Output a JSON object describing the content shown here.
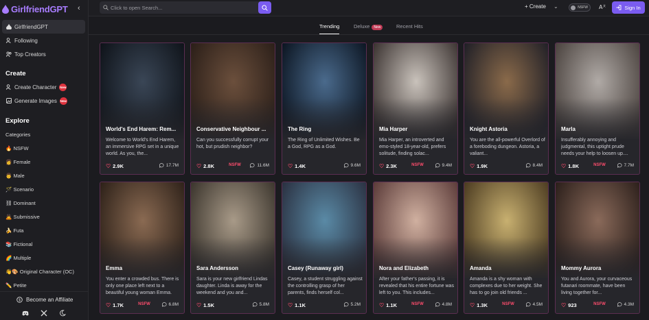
{
  "app": {
    "brand": "GirlfriendGPT",
    "collapse_icon": "chevron-left-icon"
  },
  "sidebar": {
    "nav": [
      {
        "label": "GirlfriendGPT",
        "icon": "logo-icon",
        "active": true
      },
      {
        "label": "Following",
        "icon": "user-plus-icon",
        "active": false
      },
      {
        "label": "Top Creators",
        "icon": "users-icon",
        "active": false
      }
    ],
    "create_heading": "Create",
    "create_items": [
      {
        "label": "Create Character",
        "icon": "user-plus-icon",
        "badge": "New"
      },
      {
        "label": "Generate Images",
        "icon": "image-icon",
        "badge": "New"
      }
    ],
    "explore_heading": "Explore",
    "categories_label": "Categories",
    "categories": [
      {
        "emoji": "🔥",
        "label": "NSFW"
      },
      {
        "emoji": "👩",
        "label": "Female"
      },
      {
        "emoji": "👨",
        "label": "Male"
      },
      {
        "emoji": "🪄",
        "label": "Scenario"
      },
      {
        "emoji": "⛓",
        "label": "Dominant"
      },
      {
        "emoji": "🙇",
        "label": "Submissive"
      },
      {
        "emoji": "🍌",
        "label": "Futa"
      },
      {
        "emoji": "📚",
        "label": "Fictional"
      },
      {
        "emoji": "🌈",
        "label": "Multiple"
      },
      {
        "emoji": "👋🎨",
        "label": "Original Character (OC)"
      },
      {
        "emoji": "✏️",
        "label": "Petite"
      }
    ],
    "affiliate_label": "Become an Affiliate",
    "footer_icons": [
      "discord-icon",
      "x-icon",
      "moon-icon"
    ]
  },
  "topbar": {
    "search_placeholder": "Click to open Search...",
    "create_label": "+ Create",
    "nsfw_label": "NSFW",
    "signin_label": "Sign In"
  },
  "tabs": [
    {
      "label": "Trending",
      "active": true
    },
    {
      "label": "Deluxe",
      "badge": "New",
      "active": false
    },
    {
      "label": "Recent Hits",
      "active": false
    }
  ],
  "cards": [
    {
      "name": "World's End Harem: Rem...",
      "desc": "Welcome to World's End Harem, an immersive RPG set in a unique world. As you, the...",
      "likes": "2.9K",
      "nsfw": "",
      "chats": "17.7M",
      "bg": [
        "#3a4656",
        "#0e1218"
      ]
    },
    {
      "name": "Conservative Neighbour ...",
      "desc": "Can you successfully corrupt your hot, but prudish neighbor?",
      "likes": "2.8K",
      "nsfw": "NSFW",
      "chats": "11.6M",
      "bg": [
        "#6b4f3c",
        "#2a1e18"
      ]
    },
    {
      "name": "The Ring",
      "desc": "The Ring of Unlimited Wishes. Be a God, RPG as a God.",
      "likes": "1.4K",
      "nsfw": "",
      "chats": "9.6M",
      "bg": [
        "#4a6a8c",
        "#0b1420"
      ]
    },
    {
      "name": "Mia Harper",
      "desc": "Mia Harper, an introverted and emo-styled 18-year-old, prefers solitude, finding solac...",
      "likes": "2.3K",
      "nsfw": "NSFW",
      "chats": "9.4M",
      "bg": [
        "#c9c2bb",
        "#3a3230"
      ]
    },
    {
      "name": "Knight Astoria",
      "desc": "You are the all-powerful Overlord of a foreboding dungeon. Astoria, a valiant...",
      "likes": "1.9K",
      "nsfw": "",
      "chats": "8.4M",
      "bg": [
        "#8a6a4a",
        "#1e1e26"
      ]
    },
    {
      "name": "Marla",
      "desc": "Insufferably annoying and judgmental, this uptight prude needs your help to loosen up....",
      "likes": "1.8K",
      "nsfw": "NSFW",
      "chats": "7.7M",
      "bg": [
        "#b0aaa6",
        "#4a423e"
      ]
    },
    {
      "name": "Emma",
      "desc": "You enter a crowded bus. There is only one place left next to a beautiful young woman Emma.",
      "likes": "1.7K",
      "nsfw": "NSFW",
      "chats": "6.8M",
      "bg": [
        "#8a6a52",
        "#2c2018"
      ]
    },
    {
      "name": "Sara Andersson",
      "desc": "Sara is your new girlfriend Lindas daughter. Linda is away for the weekend and you and...",
      "likes": "1.5K",
      "nsfw": "",
      "chats": "5.8M",
      "bg": [
        "#a89a88",
        "#3a342c"
      ]
    },
    {
      "name": "Casey (Runaway girl)",
      "desc": "Casey, a student struggling against the controlling grasp of her parents, finds herself col...",
      "likes": "1.1K",
      "nsfw": "",
      "chats": "5.2M",
      "bg": [
        "#5a8aa6",
        "#2a3040"
      ]
    },
    {
      "name": "Nora and Elizabeth",
      "desc": "After your father's passing, it is revealed that his entire fortune was left to you. This includes...",
      "likes": "1.1K",
      "nsfw": "NSFW",
      "chats": "4.8M",
      "bg": [
        "#d0b0a0",
        "#5a3a38"
      ]
    },
    {
      "name": "Amanda",
      "desc": "Amanda is a shy woman with complexes due to her weight. She has to go join old friends ...",
      "likes": "1.3K",
      "nsfw": "NSFW",
      "chats": "4.5M",
      "bg": [
        "#c8b070",
        "#4a3a20"
      ]
    },
    {
      "name": "Mommy Aurora",
      "desc": "You and Aurora, your curvaceous futanari roommate, have been living together for...",
      "likes": "923",
      "nsfw": "NSFW",
      "chats": "4.3M",
      "bg": [
        "#8a6a5a",
        "#2a1e1a"
      ]
    }
  ],
  "colors": {
    "accent": "#7a5cf0",
    "brand": "#a87dff",
    "nsfw": "#ff4d6d",
    "card_border": "#5c2e52"
  }
}
